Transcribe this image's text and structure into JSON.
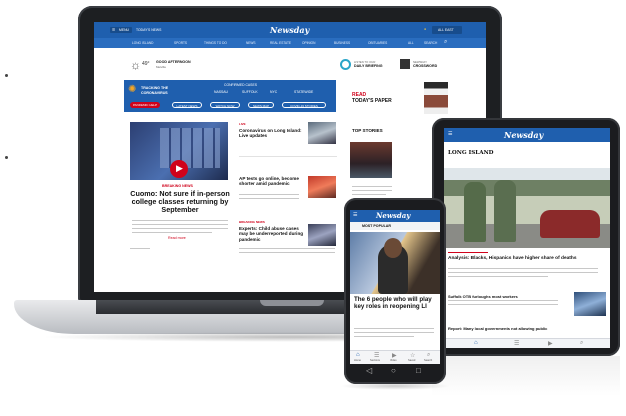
{
  "laptop": {
    "menu_label": "MENU",
    "todays_news": "TODAY'S NEWS",
    "brand": "Newsday",
    "account": "ALL EAST",
    "nav_items": [
      "LONG ISLAND",
      "SPORTS",
      "THINGS TO DO",
      "NEWS",
      "REAL ESTATE",
      "OPINION",
      "BUSINESS",
      "OBITUARIES",
      "ALL",
      "SEARCH"
    ],
    "weather_temp": "49°",
    "weather_greeting": "GOOD AFTERNOON",
    "weather_place": "Melville",
    "briefing_label": "LISTEN TO OUR",
    "briefing_title": "DAILY BRIEFING",
    "crossword_label": "NEWSDAY",
    "crossword_title": "CROSSWORD",
    "tracking_title": "TRACKING THE CORONAVIRUS",
    "tracking_stats": [
      "CONFIRMED CASES",
      "NASSAU",
      "SUFFOLK",
      "NYC",
      "STATEWIDE"
    ],
    "tracking_buttons": [
      "PANDEMIC HELP",
      "LATEST NEWS",
      "WATCH NOW",
      "NEWS MAP",
      "COVID-19 STORIES"
    ],
    "read_label": "READ",
    "read_title": "TODAY'S PAPER",
    "breaking_label": "BREAKING NEWS",
    "lead_headline": "Cuomo: Not sure if in-person college classes returning by September",
    "lead_more": "Read more",
    "list_label": "LIVE",
    "stories": [
      "Coronavirus on Long Island: Live updates",
      "AP tests go online, become shorter amid pandemic",
      "Experts: Child abuse cases may be underreported during pandemic"
    ],
    "top_stories": "TOP STORIES",
    "local_label": "BREAKING NEWS"
  },
  "tablet": {
    "brand": "Newsday",
    "section": "LONG ISLAND",
    "headline": "Analysis: Blacks, Hispanics have higher share of deaths",
    "item_a": "Suffolk OTB furloughs most workers",
    "item_b": "Report: Many local governments not allowing public"
  },
  "phone": {
    "brand": "Newsday",
    "tab": "MOST POPULAR",
    "headline": "The 6 people who will play key roles in reopening LI",
    "tabs": [
      "Home",
      "Sections",
      "Video",
      "Saved",
      "Search"
    ]
  },
  "colors": {
    "brand_blue": "#1f5fae",
    "nav_blue": "#2a6dbf",
    "alert_red": "#d0021b",
    "teal": "#2aa5c8"
  }
}
